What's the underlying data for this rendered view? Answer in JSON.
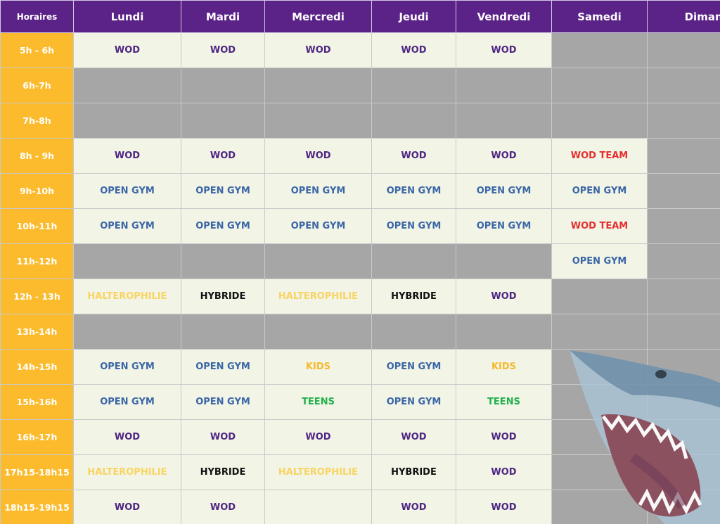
{
  "colors": {
    "header_bg": "#5b2287",
    "time_bg": "#fbbb2c",
    "slot_bg": "#f2f4e6",
    "empty_bg": "#a6a6a6",
    "wod": "#4e2682",
    "open_gym": "#3a66a7",
    "wod_team": "#e62f2f",
    "halterophilie": "#f9d462",
    "hybride": "#111111",
    "kids": "#f6b92c",
    "teens": "#22b14c"
  },
  "header": [
    "Horaires",
    "Lundi",
    "Mardi",
    "Mercredi",
    "Jeudi",
    "Vendredi",
    "Samedi",
    "Dimanche"
  ],
  "rows": [
    {
      "time": "5h - 6h",
      "cells": [
        "WOD",
        "WOD",
        "WOD",
        "WOD",
        "WOD",
        null,
        null
      ]
    },
    {
      "time": "6h-7h",
      "cells": [
        null,
        null,
        null,
        null,
        null,
        null,
        null
      ]
    },
    {
      "time": "7h-8h",
      "cells": [
        null,
        null,
        null,
        null,
        null,
        null,
        null
      ]
    },
    {
      "time": "8h - 9h",
      "cells": [
        "WOD",
        "WOD",
        "WOD",
        "WOD",
        "WOD",
        "WOD TEAM",
        null
      ]
    },
    {
      "time": "9h-10h",
      "cells": [
        "OPEN GYM",
        "OPEN GYM",
        "OPEN GYM",
        "OPEN GYM",
        "OPEN GYM",
        "OPEN GYM",
        null
      ]
    },
    {
      "time": "10h-11h",
      "cells": [
        "OPEN GYM",
        "OPEN GYM",
        "OPEN GYM",
        "OPEN GYM",
        "OPEN GYM",
        "WOD TEAM",
        null
      ]
    },
    {
      "time": "11h-12h",
      "cells": [
        null,
        null,
        null,
        null,
        null,
        "OPEN GYM",
        null
      ]
    },
    {
      "time": "12h - 13h",
      "cells": [
        "HALTEROPHILIE",
        "HYBRIDE",
        "HALTEROPHILIE",
        "HYBRIDE",
        "WOD",
        null,
        null
      ]
    },
    {
      "time": "13h-14h",
      "cells": [
        null,
        null,
        null,
        null,
        null,
        null,
        null
      ]
    },
    {
      "time": "14h-15h",
      "cells": [
        "OPEN GYM",
        "OPEN GYM",
        "KIDS",
        "OPEN GYM",
        "KIDS",
        null,
        null
      ]
    },
    {
      "time": "15h-16h",
      "cells": [
        "OPEN GYM",
        "OPEN GYM",
        "TEENS",
        "OPEN GYM",
        "TEENS",
        null,
        null
      ]
    },
    {
      "time": "16h-17h",
      "cells": [
        "WOD",
        "WOD",
        "WOD",
        "WOD",
        "WOD",
        null,
        null
      ]
    },
    {
      "time": "17h15-18h15",
      "cells": [
        "HALTEROPHILIE",
        "HYBRIDE",
        "HALTEROPHILIE",
        "HYBRIDE",
        "WOD",
        null,
        null
      ]
    },
    {
      "time": "18h15-19h15",
      "cells": [
        "WOD",
        "WOD",
        "",
        "WOD",
        "WOD",
        null,
        null
      ]
    }
  ]
}
